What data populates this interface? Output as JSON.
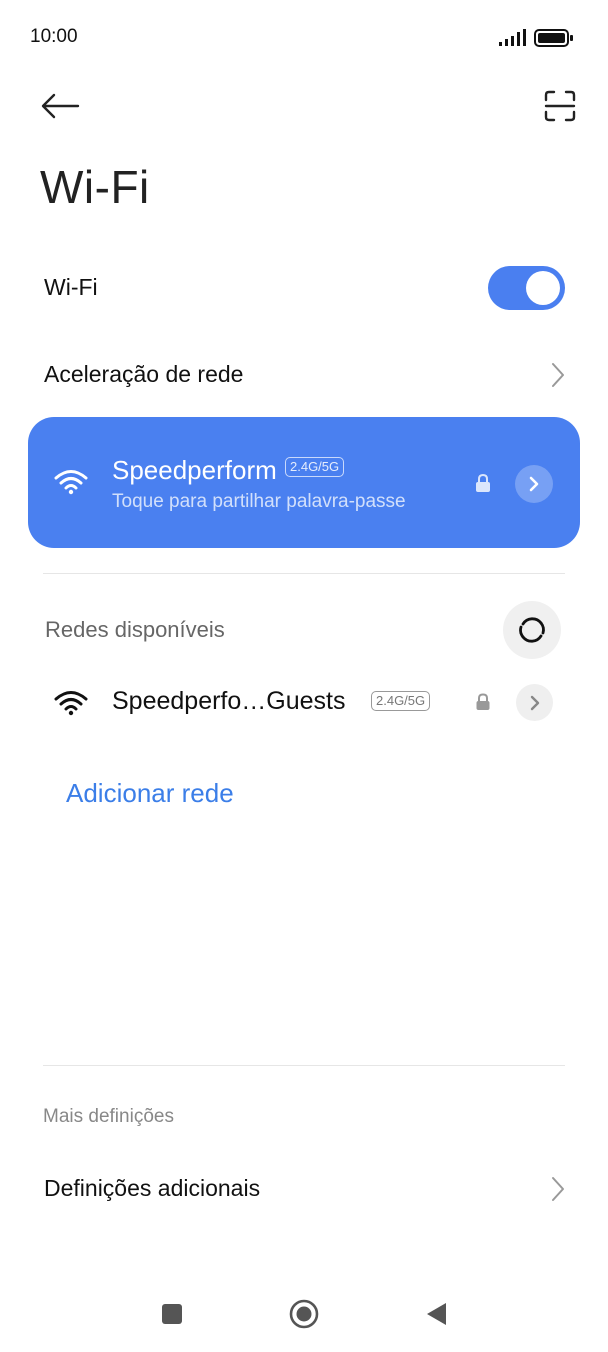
{
  "status_bar": {
    "time": "10:00"
  },
  "header": {
    "title": "Wi-Fi"
  },
  "wifi_toggle": {
    "label": "Wi-Fi",
    "enabled": true
  },
  "network_acceleration": {
    "label": "Aceleração de rede"
  },
  "connected_network": {
    "name": "Speedperform",
    "band": "2.4G/5G",
    "subtitle": "Toque para partilhar palavra-passe",
    "secured": true
  },
  "available_networks": {
    "label": "Redes disponíveis",
    "items": [
      {
        "name": "Speedperfo…Guests",
        "band": "2.4G/5G",
        "secured": true
      }
    ]
  },
  "add_network": {
    "label": "Adicionar rede"
  },
  "more_settings": {
    "section_label": "Mais definições",
    "additional_label": "Definições adicionais"
  },
  "colors": {
    "accent": "#4a80f0",
    "link": "#3b7ee8"
  }
}
